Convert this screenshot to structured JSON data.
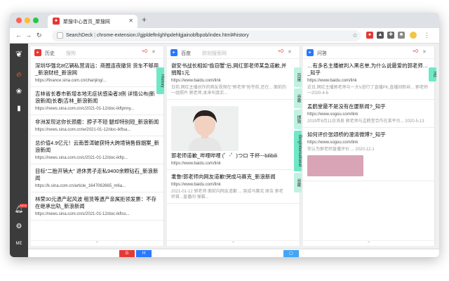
{
  "browser": {
    "tab_title": "聚搜中心首页_聚搜网",
    "tab_favicon": "red-app-icon",
    "omnibox_app": "SearchDeck",
    "omnibox_url": "chrome-extension://gjpldeftnlghhpdehlgjainobfbpob/index.html#history",
    "colors": {
      "tabbar": "#dee1e6",
      "accent": "#e53935"
    }
  },
  "sidebar": {
    "items": [
      {
        "icon": "app-logo-icon"
      },
      {
        "icon": "fire-icon"
      },
      {
        "icon": "paw-icon"
      },
      {
        "icon": "book-icon"
      },
      {
        "icon": "bell-icon",
        "badge": "NEW"
      },
      {
        "icon": "gear-icon"
      },
      {
        "label": "ME"
      }
    ]
  },
  "columns": [
    {
      "name": "历史",
      "query": "搜狗",
      "logo_color": "#e53935",
      "action": "+0",
      "results": [
        {
          "title": "深圳华强北8亿辆私营清远：商圈连夜撤货 货车不够用_新浪财经_新浪网",
          "url": "https://finance.sina.com.cn/chanjing/..."
        },
        {
          "title": "吉林省长春市新增本地无症状感染者3例 详情公布|新浪新闻|长春|吉林_新浪新闻",
          "url": "https://news.sina.com.cn/c/2021-01-12/doc-ikftpnny..."
        },
        {
          "title": "非洲发现这你长颈鹿：脖子不短 腿却特别短_新浪新闻",
          "url": "https://news.sina.com.cn/w/2021-01-12/doc-ikftsa..."
        },
        {
          "title": "总价值4.9亿元！云南普洱破获特大跨境销售假烟案_新浪新闻",
          "url": "https://news.sina.com.cn/c/2021-01-12/doc-ikftp..."
        },
        {
          "title": "目标“二胎开销大” 退休男子走私9400余颗钻石_新浪新闻",
          "url": "https://k.sina.com.cn/article_1647062665_m6a..."
        },
        {
          "title": "林荣30元遗产起风波 租赁等遗产亲属拒领发票：不存在继承出轨_新浪新闻",
          "url": "https://news.sina.com.cn/s/2021-01-12/doc-ikftss..."
        }
      ],
      "tags": [
        "History"
      ],
      "footer": "⌃"
    },
    {
      "name": "百度",
      "query": "即刻搜索网",
      "logo_color": "#2979ff",
      "action": "+0",
      "results": [
        {
          "title": "谢安书战长相如“偷窃蟹”后,网红郭老师某急道歉,并捐赠1元",
          "url": "https://www.baidu.com/link",
          "snippet": "日前,网红主播创作的网友视频在“郭老师”抢夺前,还在... 面前的一组照片 郭老师,本来叫真实..."
        },
        {
          "title": "郭老师道歉_哔哩哔哩 (゜-゜)つロ 干杯~-bilibili",
          "url": "https://www.baidu.com/link",
          "image": "portrait-photo"
        },
        {
          "title": "耄鲁!郭老师向网友道歉!哭成马赛克_新浪新闻",
          "url": "https://www.baidu.com/link",
          "snippet": "2021-01-12 郭老师 面前向网友道歉 ... 哭成马赛克 原告 郭老师首...直播间 弹幕..."
        }
      ],
      "tags": [
        "百度",
        "谷歌",
        "搜狗",
        "BingInternational",
        "谷歌"
      ],
      "footer": "⌃"
    },
    {
      "name": "问答",
      "query": "",
      "logo_color": "#2979ff",
      "action": "+0",
      "results": [
        {
          "title": "…有多名主播被判入黑名单,为什么说最爱的郭老师…_知乎",
          "url": "https://www.baidu.com/link",
          "snippet": "近日,网红主播郭老师与一大V进行了直播PK,直播间粉丝... 郭老师 一2020-4-6"
        },
        {
          "title": "孟鹤堂最不是没有在厦新闻?_知乎",
          "url": "https://www.sogou.com/link",
          "snippet": "2019年6月11日消息 郭老师与孟鹤堂合作在某平台... 2020-5-13"
        },
        {
          "title": "如何评价张颂桥的澄清微博?_知乎",
          "url": "https://www.sogou.com/link",
          "snippet": "你认为郭老师直播评价 ... 2020-12-1"
        }
      ],
      "tags": [
        "Hd"
      ],
      "footer": "⌃"
    }
  ],
  "bottom_bar": [
    {
      "label": "G",
      "color": "#e53935"
    },
    {
      "label": "H",
      "color": "#2979ff"
    },
    {
      "label": "",
      "color": "#42a5f5"
    }
  ]
}
